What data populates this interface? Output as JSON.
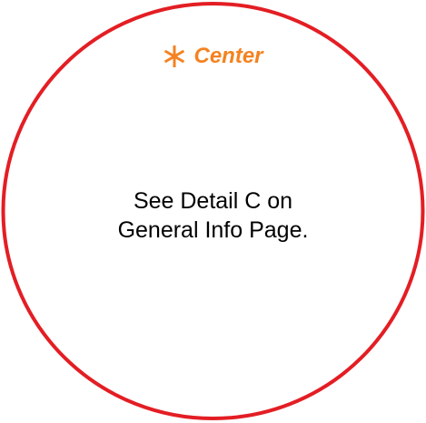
{
  "colors": {
    "circle_stroke": "#e31e24",
    "accent": "#f5821f",
    "text": "#000000",
    "background": "#ffffff"
  },
  "header": {
    "icon": "asterisk-icon",
    "label": "Center"
  },
  "note": {
    "line1": "See Detail C on",
    "line2": "General Info Page."
  }
}
